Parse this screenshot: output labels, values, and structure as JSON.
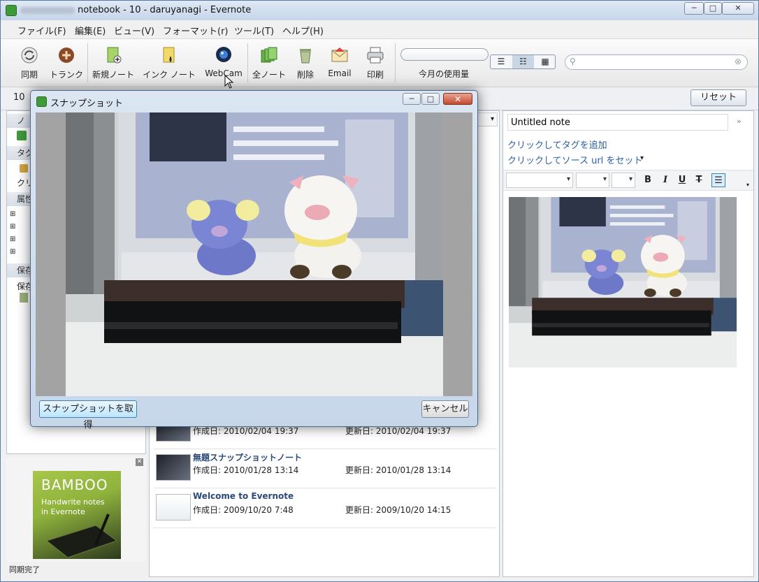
{
  "window": {
    "title": "notebook - 10 - daruyanagi - Evernote",
    "controls": [
      "─",
      "□",
      "✕"
    ]
  },
  "menu": [
    "ファイル(F)",
    "編集(E)",
    "ビュー(V)",
    "フォーマット(r)",
    "ツール(T)",
    "ヘルプ(H)"
  ],
  "toolbar": {
    "sync": "同期",
    "trunk": "トランク",
    "new_note": "新規ノート",
    "ink_note": "インク ノート",
    "webcam": "WebCam",
    "all_notes": "全ノート",
    "delete": "削除",
    "email": "Email",
    "print": "印刷",
    "usage_label": "今月の使用量",
    "search_placeholder": ""
  },
  "row2": {
    "count": "10",
    "reset": "リセット"
  },
  "left_pane": {
    "sections": [
      "ノ",
      "タグ",
      "属性",
      "保存"
    ],
    "items": [
      "クリ",
      "保存"
    ]
  },
  "ad": {
    "logo": "BAMBOO",
    "line1": "Handwrite notes",
    "line2": "in Evernote",
    "close": "✕"
  },
  "status": "同期完了",
  "notes": [
    {
      "title": "",
      "created": "作成日: 2010/02/04 19:37",
      "updated": "更新日: 2010/02/04 19:37"
    },
    {
      "title": "無題スナップショットノート",
      "created": "作成日: 2010/01/28 13:14",
      "updated": "更新日: 2010/01/28 13:14"
    },
    {
      "title": "Welcome to Evernote",
      "created": "作成日: 2009/10/20 7:48",
      "updated": "更新日: 2009/10/20 14:15"
    }
  ],
  "editor": {
    "title_value": "Untitled note",
    "add_tag": "クリックしてタグを追加",
    "set_source": "クリックしてソース url をセット",
    "bold": "B",
    "italic": "I",
    "underline": "U",
    "strike": "T"
  },
  "dialog": {
    "title": "スナップショット",
    "snap_button": "スナップショットを取得",
    "cancel_button": "キャンセル",
    "close": "✕"
  },
  "colors": {
    "accent": "#2b5fa6",
    "evernote_green": "#3f9b3a"
  }
}
